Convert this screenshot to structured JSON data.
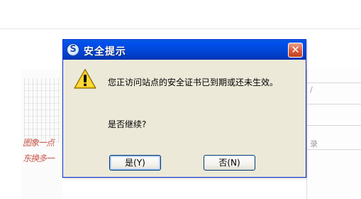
{
  "dialog": {
    "title": "安全提示",
    "message": "您正访问站点的安全证书已到期或还未生效。",
    "question": "是否继续?",
    "yes_label": "是(Y)",
    "no_label": "否(N)",
    "close_glyph": "✕",
    "title_icon_glyph": "S",
    "icon": "warning-icon"
  },
  "background": {
    "scribble_line1": "图象一点",
    "scribble_line2": "东换多一",
    "right_text1": "/",
    "right_text2": "录"
  },
  "colors": {
    "titlebar": "#0050ee",
    "dialog_body": "#ece9d8",
    "close_button": "#d85a3a",
    "warning": "#f5c400"
  }
}
